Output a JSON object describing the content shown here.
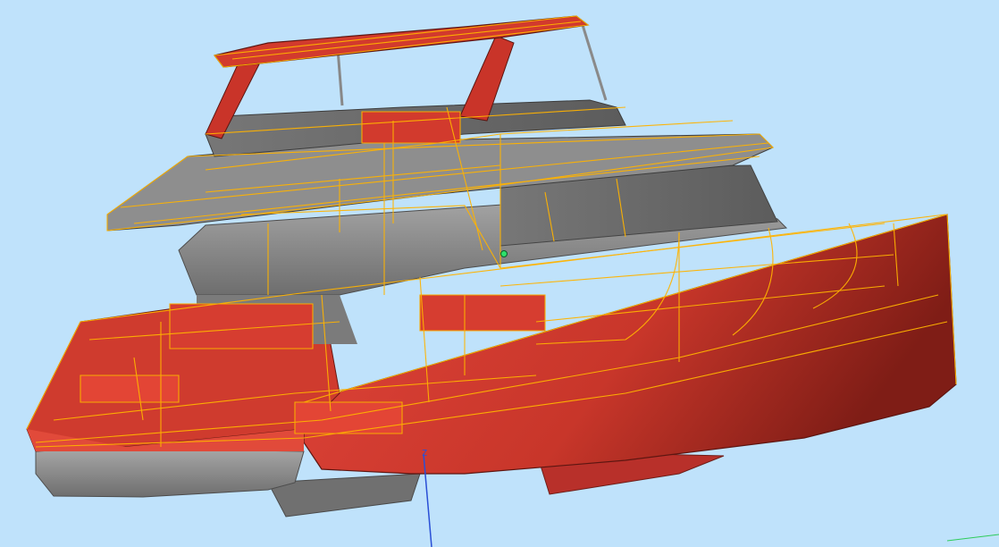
{
  "viewport": {
    "background_color": "#bfe2fb",
    "model": "catamaran",
    "render_mode": "shaded-with-selection-wireframe",
    "selection_color": "#ffb300",
    "hull_color": "#c8362a",
    "superstructure_color": "#8c8c8c",
    "axis_label": "Z"
  }
}
